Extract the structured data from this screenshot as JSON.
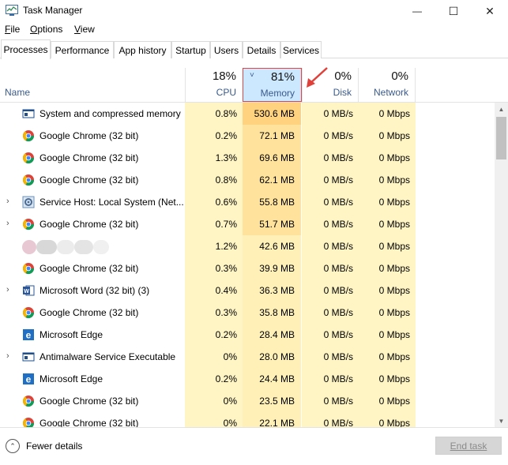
{
  "window": {
    "title": "Task Manager",
    "minimize_glyph": "—",
    "maximize_glyph": "☐",
    "close_glyph": "✕"
  },
  "menu": [
    "File",
    "Options",
    "View"
  ],
  "menu_underline": [
    "F",
    "O",
    "V"
  ],
  "tabs": [
    "Processes",
    "Performance",
    "App history",
    "Startup",
    "Users",
    "Details",
    "Services"
  ],
  "active_tab": "Processes",
  "header": {
    "name_label": "Name",
    "columns": [
      {
        "pct": "18%",
        "label": "CPU"
      },
      {
        "pct": "81%",
        "label": "Memory",
        "sorted": true
      },
      {
        "pct": "0%",
        "label": "Disk"
      },
      {
        "pct": "0%",
        "label": "Network"
      }
    ],
    "sort_glyph": "˅"
  },
  "colors": {
    "cpu_column": "#fff4c4",
    "memory_high": "#ffd27f",
    "memory_med": "#ffe39d",
    "memory_low": "#fff0b8",
    "highlight_border": "#e04646",
    "arrow": "#e0403a"
  },
  "processes": [
    {
      "name": "System and compressed memory",
      "icon": "system-icon",
      "expandable": false,
      "cpu": "0.8%",
      "memory": "530.6 MB",
      "disk": "0 MB/s",
      "network": "0 Mbps"
    },
    {
      "name": "Google Chrome (32 bit)",
      "icon": "chrome-icon",
      "expandable": false,
      "cpu": "0.2%",
      "memory": "72.1 MB",
      "disk": "0 MB/s",
      "network": "0 Mbps"
    },
    {
      "name": "Google Chrome (32 bit)",
      "icon": "chrome-icon",
      "expandable": false,
      "cpu": "1.3%",
      "memory": "69.6 MB",
      "disk": "0 MB/s",
      "network": "0 Mbps"
    },
    {
      "name": "Google Chrome (32 bit)",
      "icon": "chrome-icon",
      "expandable": false,
      "cpu": "0.8%",
      "memory": "62.1 MB",
      "disk": "0 MB/s",
      "network": "0 Mbps"
    },
    {
      "name": "Service Host: Local System (Net...",
      "icon": "gear-icon",
      "expandable": true,
      "cpu": "0.6%",
      "memory": "55.8 MB",
      "disk": "0 MB/s",
      "network": "0 Mbps"
    },
    {
      "name": "Google Chrome (32 bit)",
      "icon": "chrome-icon",
      "expandable": true,
      "cpu": "0.7%",
      "memory": "51.7 MB",
      "disk": "0 MB/s",
      "network": "0 Mbps"
    },
    {
      "name": "",
      "icon": "blurred-icon",
      "expandable": false,
      "cpu": "1.2%",
      "memory": "42.6 MB",
      "disk": "0 MB/s",
      "network": "0 Mbps"
    },
    {
      "name": "Google Chrome (32 bit)",
      "icon": "chrome-icon",
      "expandable": false,
      "cpu": "0.3%",
      "memory": "39.9 MB",
      "disk": "0 MB/s",
      "network": "0 Mbps"
    },
    {
      "name": "Microsoft Word (32 bit) (3)",
      "icon": "word-icon",
      "expandable": true,
      "cpu": "0.4%",
      "memory": "36.3 MB",
      "disk": "0 MB/s",
      "network": "0 Mbps"
    },
    {
      "name": "Google Chrome (32 bit)",
      "icon": "chrome-icon",
      "expandable": false,
      "cpu": "0.3%",
      "memory": "35.8 MB",
      "disk": "0 MB/s",
      "network": "0 Mbps"
    },
    {
      "name": "Microsoft Edge",
      "icon": "edge-icon",
      "expandable": false,
      "cpu": "0.2%",
      "memory": "28.4 MB",
      "disk": "0 MB/s",
      "network": "0 Mbps"
    },
    {
      "name": "Antimalware Service Executable",
      "icon": "system-icon",
      "expandable": true,
      "cpu": "0%",
      "memory": "28.0 MB",
      "disk": "0 MB/s",
      "network": "0 Mbps"
    },
    {
      "name": "Microsoft Edge",
      "icon": "edge-icon",
      "expandable": false,
      "cpu": "0.2%",
      "memory": "24.4 MB",
      "disk": "0 MB/s",
      "network": "0 Mbps"
    },
    {
      "name": "Google Chrome (32 bit)",
      "icon": "chrome-icon",
      "expandable": false,
      "cpu": "0%",
      "memory": "23.5 MB",
      "disk": "0 MB/s",
      "network": "0 Mbps"
    },
    {
      "name": "Google Chrome (32 bit)",
      "icon": "chrome-icon",
      "expandable": false,
      "cpu": "0%",
      "memory": "22.1 MB",
      "disk": "0 MB/s",
      "network": "0 Mbps"
    }
  ],
  "expand_glyph": "›",
  "footer": {
    "fewer_details": "Fewer details",
    "fewer_glyph": "⌃",
    "end_task": "End task"
  }
}
